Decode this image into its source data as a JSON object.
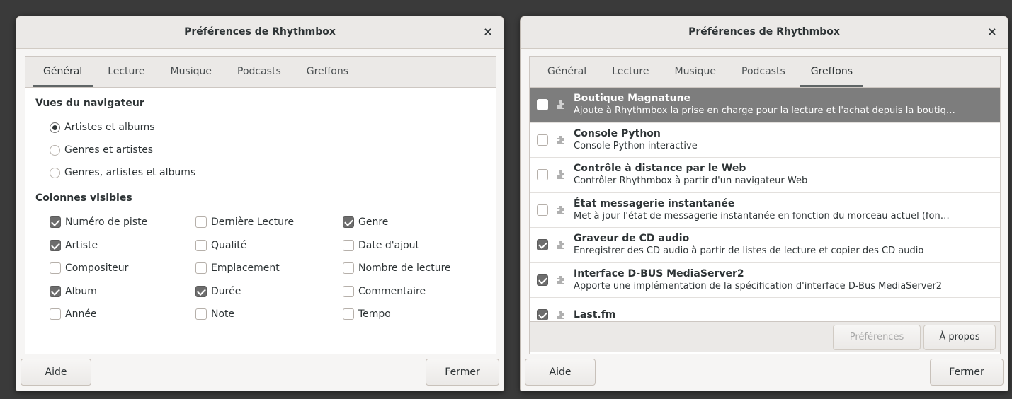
{
  "left_dialog": {
    "title": "Préférences de Rhythmbox",
    "close_glyph": "×",
    "tabs": [
      {
        "label": "Général",
        "active": true
      },
      {
        "label": "Lecture",
        "active": false
      },
      {
        "label": "Musique",
        "active": false
      },
      {
        "label": "Podcasts",
        "active": false
      },
      {
        "label": "Greffons",
        "active": false
      }
    ],
    "browser_views": {
      "title": "Vues du navigateur",
      "options": [
        {
          "label": "Artistes et albums",
          "selected": true
        },
        {
          "label": "Genres et artistes",
          "selected": false
        },
        {
          "label": "Genres, artistes et albums",
          "selected": false
        }
      ]
    },
    "visible_columns": {
      "title": "Colonnes visibles",
      "items": [
        {
          "label": "Numéro de piste",
          "checked": true
        },
        {
          "label": "Dernière Lecture",
          "checked": false
        },
        {
          "label": "Genre",
          "checked": true
        },
        {
          "label": "Artiste",
          "checked": true
        },
        {
          "label": "Qualité",
          "checked": false
        },
        {
          "label": "Date d'ajout",
          "checked": false
        },
        {
          "label": "Compositeur",
          "checked": false
        },
        {
          "label": "Emplacement",
          "checked": false
        },
        {
          "label": "Nombre de lecture",
          "checked": false
        },
        {
          "label": "Album",
          "checked": true
        },
        {
          "label": "Durée",
          "checked": true
        },
        {
          "label": "Commentaire",
          "checked": false
        },
        {
          "label": "Année",
          "checked": false
        },
        {
          "label": "Note",
          "checked": false
        },
        {
          "label": "Tempo",
          "checked": false
        }
      ]
    },
    "buttons": {
      "help": "Aide",
      "close": "Fermer"
    }
  },
  "right_dialog": {
    "title": "Préférences de Rhythmbox",
    "close_glyph": "×",
    "tabs": [
      {
        "label": "Général",
        "active": false
      },
      {
        "label": "Lecture",
        "active": false
      },
      {
        "label": "Musique",
        "active": false
      },
      {
        "label": "Podcasts",
        "active": false
      },
      {
        "label": "Greffons",
        "active": true
      }
    ],
    "plugins": [
      {
        "name": "Boutique Magnatune",
        "description": "Ajoute à Rhythmbox la prise en charge pour la lecture et l'achat depuis la boutiq…",
        "enabled": false,
        "selected": true,
        "icon": "plugin-icon"
      },
      {
        "name": "Console Python",
        "description": "Console Python interactive",
        "enabled": false,
        "selected": false,
        "icon": "plugin-icon"
      },
      {
        "name": "Contrôle à distance par le Web",
        "description": "Contrôler Rhythmbox à partir d'un navigateur Web",
        "enabled": false,
        "selected": false,
        "icon": "plugin-icon"
      },
      {
        "name": "État messagerie instantanée",
        "description": "Met à jour l'état de messagerie instantanée en fonction du morceau actuel (fon…",
        "enabled": false,
        "selected": false,
        "icon": "plugin-icon"
      },
      {
        "name": "Graveur de CD audio",
        "description": "Enregistrer des CD audio à partir de listes de lecture et copier des CD audio",
        "enabled": true,
        "selected": false,
        "icon": "plugin-icon"
      },
      {
        "name": "Interface D-BUS MediaServer2",
        "description": "Apporte une implémentation de la spécification d'interface D-Bus MediaServer2",
        "enabled": true,
        "selected": false,
        "icon": "plugin-icon"
      },
      {
        "name": "Last.fm",
        "description": "",
        "enabled": true,
        "selected": false,
        "icon": "plugin-icon"
      }
    ],
    "plugin_buttons": {
      "preferences": "Préférences",
      "about": "À propos"
    },
    "buttons": {
      "help": "Aide",
      "close": "Fermer"
    }
  }
}
